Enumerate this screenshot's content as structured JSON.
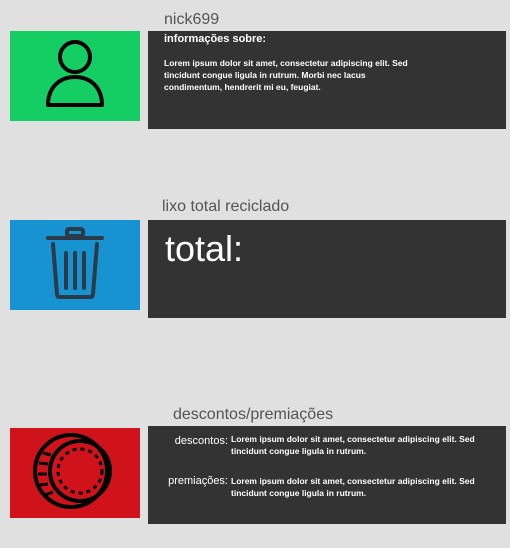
{
  "profile": {
    "username": "nick699",
    "heading": "informações sobre:",
    "text": "Lorem ipsum dolor sit amet, consectetur adipiscing elit. Sed tincidunt congue ligula in rutrum. Morbi nec lacus condimentum, hendrerit mi eu, feugiat.",
    "icon": "user-icon",
    "color": "#14cd63"
  },
  "recycle": {
    "title": "lixo total reciclado",
    "total_label": "total:",
    "icon": "trash-icon",
    "color": "#1893d1"
  },
  "rewards": {
    "title": "descontos/premiações",
    "descontos_label": "descontos:",
    "descontos_text": "Lorem ipsum dolor sit amet, consectetur adipiscing elit. Sed tincidunt congue ligula in rutrum.",
    "premiacoes_label": "premiações:",
    "premiacoes_text": "Lorem ipsum dolor sit amet, consectetur adipiscing elit. Sed tincidunt congue ligula in rutrum.",
    "icon": "coin-icon",
    "color": "#d0131b"
  }
}
